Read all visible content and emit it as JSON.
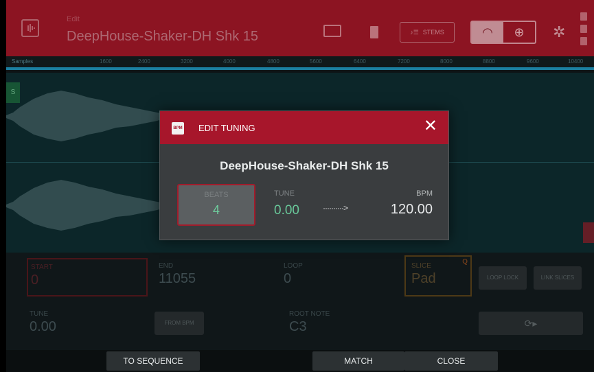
{
  "header": {
    "mode_label": "Edit",
    "sample_name": "DeepHouse-Shaker-DH Shk 15",
    "stems_label": "STEMS",
    "icons": [
      "waveform-icon",
      "keyboard-icon",
      "trash-icon",
      "headphones-icon",
      "zoom-icon",
      "gear-icon",
      "battery-icon"
    ]
  },
  "ruler": {
    "label": "Samples",
    "ticks": [
      "1600",
      "2400",
      "3200",
      "4000",
      "4800",
      "5600",
      "6400",
      "7200",
      "8000",
      "8800",
      "9600",
      "10400"
    ]
  },
  "params": {
    "start_label": "START",
    "start_value": "0",
    "end_label": "END",
    "end_value": "11055",
    "loop_label": "LOOP",
    "loop_value": "0",
    "slice_label": "SLICE",
    "slice_value": "Pad",
    "slice_badge": "Q",
    "tune_label": "TUNE",
    "tune_value": "0.00",
    "from_bpm_label": "FROM BPM",
    "root_note_label": "ROOT NOTE",
    "root_note_value": "C3",
    "loop_lock_label": "LOOP LOCK",
    "link_slices_label": "LINK SLICES"
  },
  "bottom_bar": {
    "to_sequence": "TO SEQUENCE",
    "match": "MATCH",
    "close": "CLOSE"
  },
  "dialog": {
    "icon_text": "BPM",
    "title": "EDIT TUNING",
    "sample_name": "DeepHouse-Shaker-DH Shk 15",
    "beats_label": "BEATS",
    "beats_value": "4",
    "tune_label": "TUNE",
    "tune_value": "0.00",
    "arrow": "··········>",
    "bpm_label": "BPM",
    "bpm_value": "120.00"
  },
  "colors": {
    "header_red": "#8c1422",
    "dialog_red": "#a7162b",
    "accent_green": "#69c89a",
    "wave_bg": "#0c2629",
    "ruler_line": "#1b7fa0"
  }
}
